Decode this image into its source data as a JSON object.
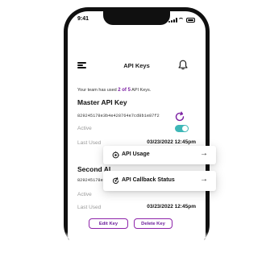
{
  "status_bar": {
    "time": "9:41"
  },
  "nav": {
    "title": "API Keys"
  },
  "usage": {
    "prefix": "Your team has used ",
    "highlight": "2 of 5",
    "suffix": " API Keys."
  },
  "master_key": {
    "title": "Master API Key",
    "hash": "829245178e3b4e428764e7cd8b1e87f2",
    "status_label": "Active",
    "status_on": true,
    "last_used_label": "Last Used",
    "last_used_value": "03/23/2022 12:45pm"
  },
  "second_key": {
    "title": "Second AI",
    "hash": "829245178e3",
    "status_label": "Active",
    "last_used_label": "Last Used",
    "last_used_value": "03/23/2022 12:45pm"
  },
  "buttons": {
    "edit": "Edit Key",
    "delete": "Delete Key"
  },
  "popups": [
    {
      "label": "API Usage",
      "icon": "api-usage-icon"
    },
    {
      "label": "API Callback Status",
      "icon": "api-callback-icon"
    }
  ],
  "colors": {
    "accent": "#7b1fa2",
    "toggle": "#3eb7b7",
    "phone": "#101010"
  }
}
